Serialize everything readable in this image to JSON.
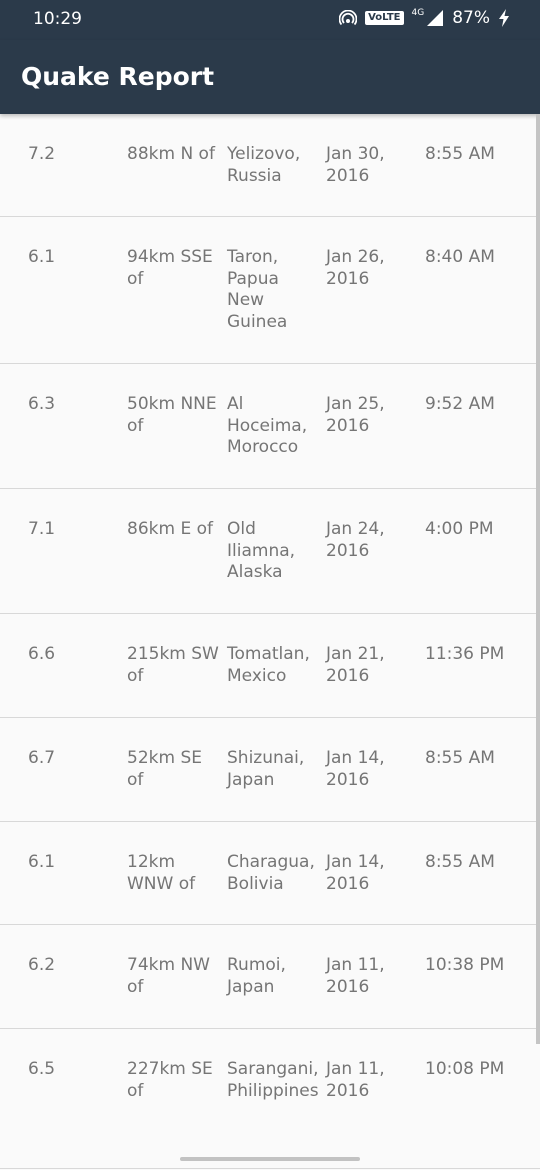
{
  "status_bar": {
    "time": "10:29",
    "volte": "VoLTE",
    "network": "4G",
    "battery": "87%"
  },
  "app_bar": {
    "title": "Quake Report"
  },
  "quakes": [
    {
      "magnitude": "7.2",
      "offset": "88km N of",
      "location": "Yelizovo, Russia",
      "date": "Jan 30, 2016",
      "time": "8:55 AM"
    },
    {
      "magnitude": "6.1",
      "offset": "94km SSE of",
      "location": "Taron, Papua New Guinea",
      "date": "Jan 26, 2016",
      "time": "8:40 AM"
    },
    {
      "magnitude": "6.3",
      "offset": "50km NNE of",
      "location": "Al Hoceima, Morocco",
      "date": "Jan 25, 2016",
      "time": "9:52 AM"
    },
    {
      "magnitude": "7.1",
      "offset": "86km E of",
      "location": "Old Iliamna, Alaska",
      "date": "Jan 24, 2016",
      "time": "4:00 PM"
    },
    {
      "magnitude": "6.6",
      "offset": "215km SW of",
      "location": "Tomatlan, Mexico",
      "date": "Jan 21, 2016",
      "time": "11:36 PM"
    },
    {
      "magnitude": "6.7",
      "offset": "52km SE of",
      "location": "Shizunai, Japan",
      "date": "Jan 14, 2016",
      "time": "8:55 AM"
    },
    {
      "magnitude": "6.1",
      "offset": "12km WNW of",
      "location": "Charagua, Bolivia",
      "date": "Jan 14, 2016",
      "time": "8:55 AM"
    },
    {
      "magnitude": "6.2",
      "offset": "74km NW of",
      "location": "Rumoi, Japan",
      "date": "Jan 11, 2016",
      "time": "10:38 PM"
    },
    {
      "magnitude": "6.5",
      "offset": "227km SE of",
      "location": "Sarangani, Philippines",
      "date": "Jan 11, 2016",
      "time": "10:08 PM"
    }
  ]
}
